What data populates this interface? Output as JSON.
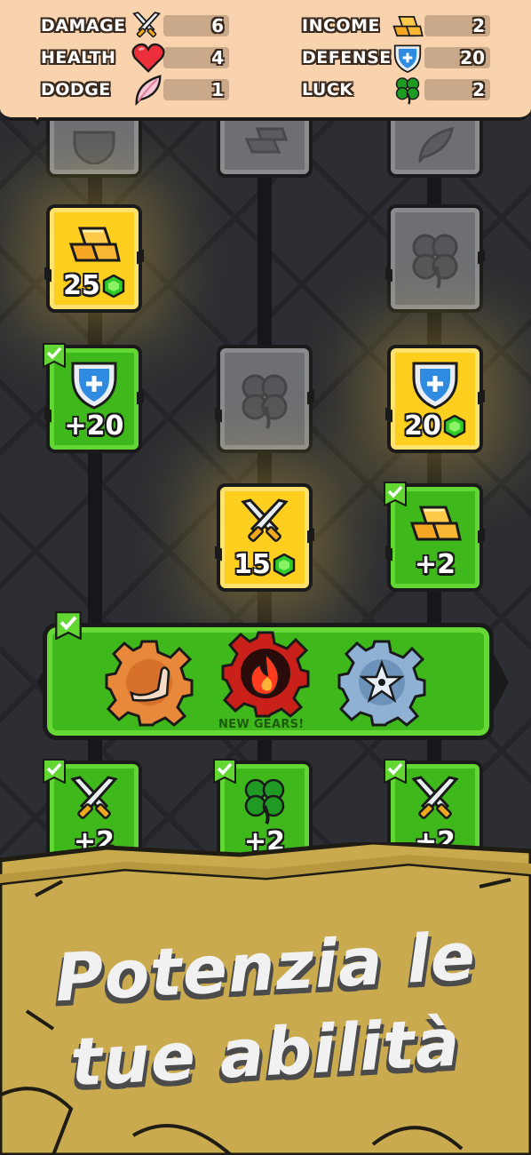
{
  "stats": {
    "left": [
      {
        "label": "DAMAGE",
        "value": "6",
        "icon": "crossed-swords-icon"
      },
      {
        "label": "HEALTH",
        "value": "4",
        "icon": "heart-icon"
      },
      {
        "label": "DODGE",
        "value": "1",
        "icon": "feather-icon"
      }
    ],
    "right": [
      {
        "label": "INCOME",
        "value": "2",
        "icon": "gold-bars-icon"
      },
      {
        "label": "DEFENSE",
        "value": "20",
        "icon": "shield-icon"
      },
      {
        "label": "LUCK",
        "value": "2",
        "icon": "clover-icon"
      }
    ]
  },
  "tiles": {
    "gold_income": {
      "price": "25",
      "icon": "gold-bars-icon",
      "state": "available"
    },
    "luck_locked": {
      "icon": "clover-icon",
      "state": "locked"
    },
    "defense_owned": {
      "text": "+20",
      "icon": "shield-icon",
      "state": "owned"
    },
    "luck_locked_mid": {
      "icon": "clover-icon",
      "state": "locked"
    },
    "defense_available": {
      "price": "20",
      "icon": "shield-icon",
      "state": "available"
    },
    "damage_available": {
      "price": "15",
      "icon": "crossed-swords-icon",
      "state": "available"
    },
    "income_owned": {
      "text": "+2",
      "icon": "gold-bars-icon",
      "state": "owned"
    },
    "damage_owned_left": {
      "text": "+2",
      "icon": "crossed-swords-icon",
      "state": "owned"
    },
    "luck_owned_mid": {
      "text": "+2",
      "icon": "clover-icon",
      "state": "owned"
    },
    "damage_owned_right": {
      "text": "+2",
      "icon": "crossed-swords-icon",
      "state": "owned"
    }
  },
  "gear_banner": {
    "caption": "NEW GEARS!",
    "gears": [
      "muscle-arm-icon",
      "fire-icon",
      "shuriken-icon"
    ]
  },
  "headline": {
    "line1": "Potenzia le",
    "line2": "tue abilità"
  },
  "colors": {
    "gold_tile": "#ffcf1f",
    "green_tile": "#3fb81c",
    "grey_tile": "#6e6f73",
    "stats_panel": "#f9d3ad",
    "parchment": "#c8a94f"
  }
}
